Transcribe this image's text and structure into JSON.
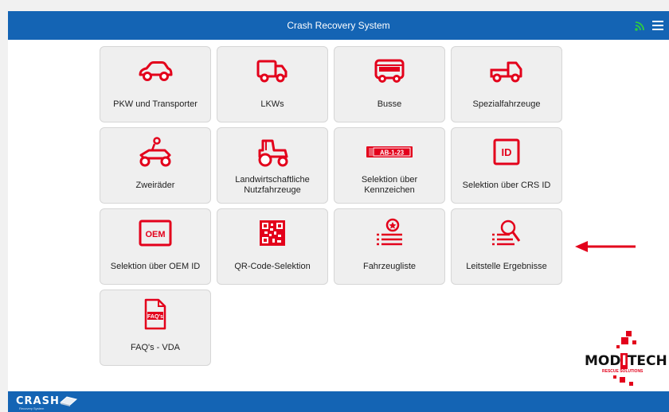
{
  "header": {
    "title": "Crash Recovery System",
    "signal_icon": "signal-icon",
    "menu_icon": "hamburger-menu-icon"
  },
  "tiles": [
    {
      "label": "PKW und Transporter",
      "icon": "car-icon"
    },
    {
      "label": "LKWs",
      "icon": "truck-icon"
    },
    {
      "label": "Busse",
      "icon": "bus-icon"
    },
    {
      "label": "Spezialfahrzeuge",
      "icon": "special-vehicle-icon"
    },
    {
      "label": "Zweiräder",
      "icon": "motorbike-icon"
    },
    {
      "label": "Landwirtschaftliche Nutzfahrzeuge",
      "icon": "tractor-icon"
    },
    {
      "label": "Selektion über Kennzeichen",
      "icon": "license-plate-icon",
      "plate_text": "AB-1-23"
    },
    {
      "label": "Selektion über CRS ID",
      "icon": "id-icon",
      "id_text": "ID"
    },
    {
      "label": "Selektion über OEM ID",
      "icon": "oem-icon",
      "oem_text": "OEM"
    },
    {
      "label": "QR-Code-Selektion",
      "icon": "qr-code-icon"
    },
    {
      "label": "Fahrzeugliste",
      "icon": "vehicle-list-icon"
    },
    {
      "label": "Leitstelle Ergebnisse",
      "icon": "search-list-icon"
    },
    {
      "label": "FAQ's - VDA",
      "icon": "faq-document-icon",
      "faq_text": "FAQ's"
    }
  ],
  "logo": {
    "word_start": "MOD",
    "word_highlight": "I",
    "word_end": "TECH",
    "tagline": "RESCUE SOLUTIONS"
  },
  "footer": {
    "brand": "CRASH",
    "brand_sub": "Recovery System"
  },
  "colors": {
    "header_bg": "#1464b4",
    "accent_red": "#e3001b",
    "signal_green": "#2ecc40"
  }
}
